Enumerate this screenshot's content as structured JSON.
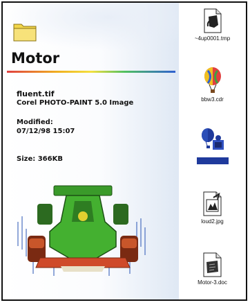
{
  "folder": {
    "title": "Motor"
  },
  "selected_file": {
    "name": "fluent.tif",
    "type": "Corel PHOTO-PAINT 5.0 Image",
    "modified_label": "Modified:",
    "modified_value": "07/12/98 15:07",
    "size": "Size: 366KB"
  },
  "files": [
    {
      "label": "~4up0001.tmp",
      "icon": "tmp-file-icon"
    },
    {
      "label": "bbw3.cdr",
      "icon": "balloon-file-icon"
    },
    {
      "label": "",
      "icon": "balloon-file-icon",
      "selected": true
    },
    {
      "label": "loud2.jpg",
      "icon": "image-file-icon"
    },
    {
      "label": "Motor-3.doc",
      "icon": "document-file-icon"
    }
  ],
  "colors": {
    "selection": "#1f3a9c",
    "folder": "#f2d64a"
  }
}
